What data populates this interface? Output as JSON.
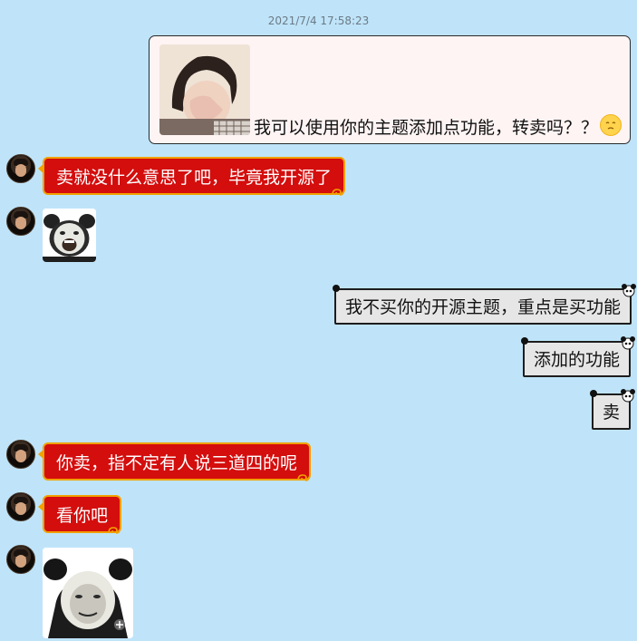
{
  "conversation": {
    "timestamp": "2021/7/4 17:58:23",
    "messages": [
      {
        "side": "right",
        "type": "text_with_image",
        "text": "我可以使用你的主题添加点功能，转卖吗？？",
        "emoji": "pleading-face"
      },
      {
        "side": "left",
        "type": "text",
        "text": "卖就没什么意思了吧，毕竟我开源了"
      },
      {
        "side": "left",
        "type": "sticker",
        "sticker": "laughing-meme-face"
      },
      {
        "side": "right",
        "type": "text",
        "text": "我不买你的开源主题，重点是买功能"
      },
      {
        "side": "right",
        "type": "text",
        "text": "添加的功能"
      },
      {
        "side": "right",
        "type": "text",
        "text": "卖"
      },
      {
        "side": "left",
        "type": "text",
        "text": "你卖，指不定有人说三道四的呢"
      },
      {
        "side": "left",
        "type": "text",
        "text": "看你吧"
      },
      {
        "side": "left",
        "type": "sticker",
        "sticker": "panda-meme-face"
      }
    ]
  },
  "colors": {
    "background": "#bfe4f9",
    "left_bubble": "#d40d0d",
    "left_bubble_border": "#f1a100",
    "right_bubble": "#e6e6e6",
    "right_bubble_border": "#1d1d1d"
  }
}
